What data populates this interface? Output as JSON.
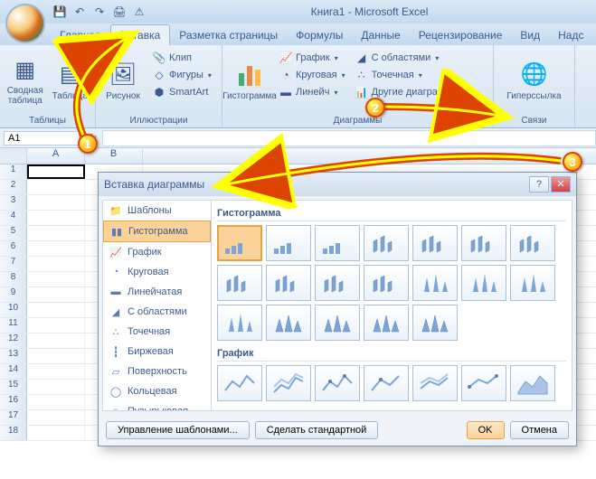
{
  "titlebar": {
    "title": "Книга1 - Microsoft Excel"
  },
  "qat": {
    "save": "💾",
    "undo": "↶",
    "redo": "↷",
    "print": "🖨",
    "warn": "⚠"
  },
  "tabs": {
    "home": "Главная",
    "insert": "Вставка",
    "layout": "Разметка страницы",
    "formulas": "Формулы",
    "data": "Данные",
    "review": "Рецензирование",
    "view": "Вид",
    "addins": "Надс"
  },
  "ribbon": {
    "tables": {
      "label": "Таблицы",
      "pivot": "Сводная\nтаблица",
      "table": "Таблица"
    },
    "illus": {
      "label": "Иллюстрации",
      "picture": "Рисунок",
      "clip": "Клип",
      "shapes": "Фигуры",
      "smartart": "SmartArt"
    },
    "charts": {
      "label": "Диаграммы",
      "histogram": "Гистограмма",
      "line": "График",
      "pie": "Круговая",
      "bar": "Линейч",
      "area": "С областями",
      "scatter": "Точечная",
      "other": "Другие диаграммы"
    },
    "links": {
      "label": "Связи",
      "hyperlink": "Гиперссылка"
    }
  },
  "formula": {
    "namebox": "A1",
    "fx": "fx"
  },
  "grid": {
    "cols": [
      "A",
      "B"
    ],
    "rows": [
      1,
      2,
      3,
      4,
      5,
      6,
      7,
      8,
      9,
      10,
      11,
      12,
      13,
      14,
      15,
      16,
      17,
      18
    ]
  },
  "dialog": {
    "title": "Вставка диаграммы",
    "help": "?",
    "close": "✕",
    "side": {
      "templates": "Шаблоны",
      "histogram": "Гистограмма",
      "line": "График",
      "pie": "Круговая",
      "bar": "Линейчатая",
      "area": "С областями",
      "scatter": "Точечная",
      "stock": "Биржевая",
      "surface": "Поверхность",
      "doughnut": "Кольцевая",
      "bubble": "Пузырьковая"
    },
    "section1": "Гистограмма",
    "section2": "График",
    "footer": {
      "manage": "Управление шаблонами...",
      "default": "Сделать стандартной",
      "ok": "OK",
      "cancel": "Отмена"
    }
  },
  "badges": {
    "b1": "1",
    "b2": "2",
    "b3": "3"
  }
}
